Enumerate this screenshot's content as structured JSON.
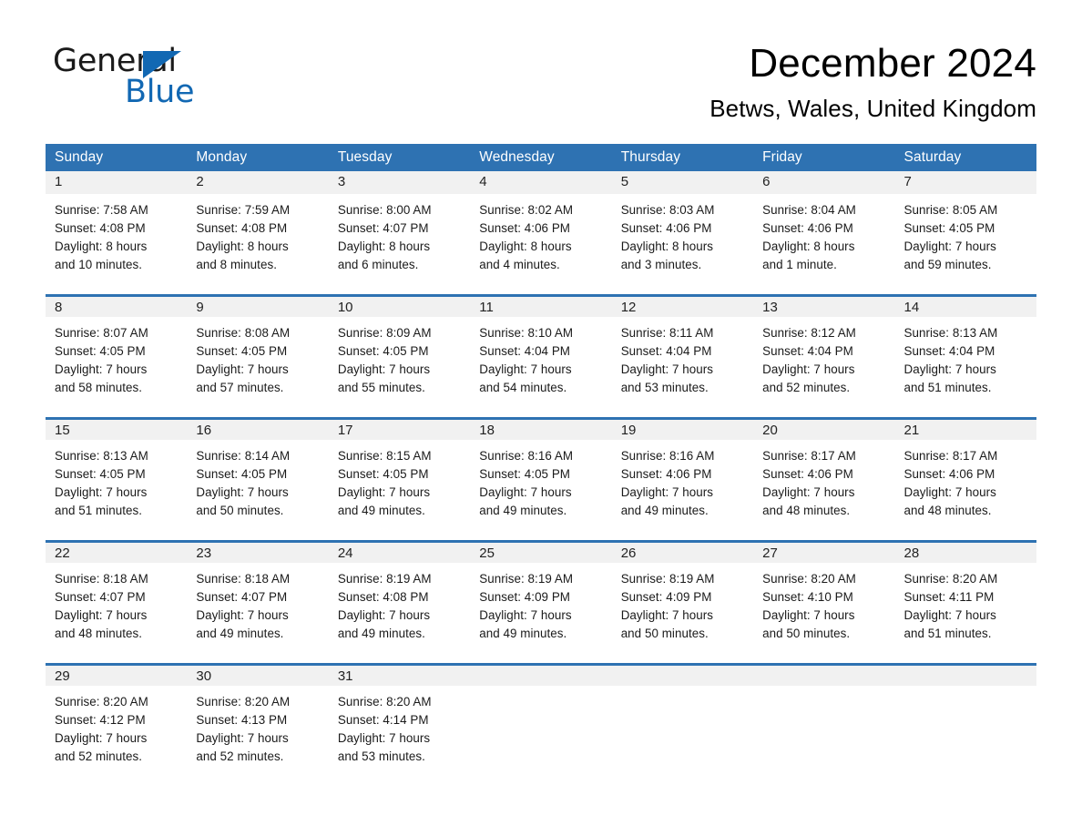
{
  "brand": {
    "name_part1": "General",
    "name_part2": "Blue",
    "accent_color": "#1268b3"
  },
  "header": {
    "month_title": "December 2024",
    "location": "Betws, Wales, United Kingdom"
  },
  "theme": {
    "header_blue": "#2e72b2",
    "date_band_gray": "#f1f1f1"
  },
  "weekdays": [
    "Sunday",
    "Monday",
    "Tuesday",
    "Wednesday",
    "Thursday",
    "Friday",
    "Saturday"
  ],
  "weeks": [
    {
      "days": [
        {
          "date": "1",
          "l1": "Sunrise: 7:58 AM",
          "l2": "Sunset: 4:08 PM",
          "l3": "Daylight: 8 hours",
          "l4": "and 10 minutes."
        },
        {
          "date": "2",
          "l1": "Sunrise: 7:59 AM",
          "l2": "Sunset: 4:08 PM",
          "l3": "Daylight: 8 hours",
          "l4": "and 8 minutes."
        },
        {
          "date": "3",
          "l1": "Sunrise: 8:00 AM",
          "l2": "Sunset: 4:07 PM",
          "l3": "Daylight: 8 hours",
          "l4": "and 6 minutes."
        },
        {
          "date": "4",
          "l1": "Sunrise: 8:02 AM",
          "l2": "Sunset: 4:06 PM",
          "l3": "Daylight: 8 hours",
          "l4": "and 4 minutes."
        },
        {
          "date": "5",
          "l1": "Sunrise: 8:03 AM",
          "l2": "Sunset: 4:06 PM",
          "l3": "Daylight: 8 hours",
          "l4": "and 3 minutes."
        },
        {
          "date": "6",
          "l1": "Sunrise: 8:04 AM",
          "l2": "Sunset: 4:06 PM",
          "l3": "Daylight: 8 hours",
          "l4": "and 1 minute."
        },
        {
          "date": "7",
          "l1": "Sunrise: 8:05 AM",
          "l2": "Sunset: 4:05 PM",
          "l3": "Daylight: 7 hours",
          "l4": "and 59 minutes."
        }
      ]
    },
    {
      "days": [
        {
          "date": "8",
          "l1": "Sunrise: 8:07 AM",
          "l2": "Sunset: 4:05 PM",
          "l3": "Daylight: 7 hours",
          "l4": "and 58 minutes."
        },
        {
          "date": "9",
          "l1": "Sunrise: 8:08 AM",
          "l2": "Sunset: 4:05 PM",
          "l3": "Daylight: 7 hours",
          "l4": "and 57 minutes."
        },
        {
          "date": "10",
          "l1": "Sunrise: 8:09 AM",
          "l2": "Sunset: 4:05 PM",
          "l3": "Daylight: 7 hours",
          "l4": "and 55 minutes."
        },
        {
          "date": "11",
          "l1": "Sunrise: 8:10 AM",
          "l2": "Sunset: 4:04 PM",
          "l3": "Daylight: 7 hours",
          "l4": "and 54 minutes."
        },
        {
          "date": "12",
          "l1": "Sunrise: 8:11 AM",
          "l2": "Sunset: 4:04 PM",
          "l3": "Daylight: 7 hours",
          "l4": "and 53 minutes."
        },
        {
          "date": "13",
          "l1": "Sunrise: 8:12 AM",
          "l2": "Sunset: 4:04 PM",
          "l3": "Daylight: 7 hours",
          "l4": "and 52 minutes."
        },
        {
          "date": "14",
          "l1": "Sunrise: 8:13 AM",
          "l2": "Sunset: 4:04 PM",
          "l3": "Daylight: 7 hours",
          "l4": "and 51 minutes."
        }
      ]
    },
    {
      "days": [
        {
          "date": "15",
          "l1": "Sunrise: 8:13 AM",
          "l2": "Sunset: 4:05 PM",
          "l3": "Daylight: 7 hours",
          "l4": "and 51 minutes."
        },
        {
          "date": "16",
          "l1": "Sunrise: 8:14 AM",
          "l2": "Sunset: 4:05 PM",
          "l3": "Daylight: 7 hours",
          "l4": "and 50 minutes."
        },
        {
          "date": "17",
          "l1": "Sunrise: 8:15 AM",
          "l2": "Sunset: 4:05 PM",
          "l3": "Daylight: 7 hours",
          "l4": "and 49 minutes."
        },
        {
          "date": "18",
          "l1": "Sunrise: 8:16 AM",
          "l2": "Sunset: 4:05 PM",
          "l3": "Daylight: 7 hours",
          "l4": "and 49 minutes."
        },
        {
          "date": "19",
          "l1": "Sunrise: 8:16 AM",
          "l2": "Sunset: 4:06 PM",
          "l3": "Daylight: 7 hours",
          "l4": "and 49 minutes."
        },
        {
          "date": "20",
          "l1": "Sunrise: 8:17 AM",
          "l2": "Sunset: 4:06 PM",
          "l3": "Daylight: 7 hours",
          "l4": "and 48 minutes."
        },
        {
          "date": "21",
          "l1": "Sunrise: 8:17 AM",
          "l2": "Sunset: 4:06 PM",
          "l3": "Daylight: 7 hours",
          "l4": "and 48 minutes."
        }
      ]
    },
    {
      "days": [
        {
          "date": "22",
          "l1": "Sunrise: 8:18 AM",
          "l2": "Sunset: 4:07 PM",
          "l3": "Daylight: 7 hours",
          "l4": "and 48 minutes."
        },
        {
          "date": "23",
          "l1": "Sunrise: 8:18 AM",
          "l2": "Sunset: 4:07 PM",
          "l3": "Daylight: 7 hours",
          "l4": "and 49 minutes."
        },
        {
          "date": "24",
          "l1": "Sunrise: 8:19 AM",
          "l2": "Sunset: 4:08 PM",
          "l3": "Daylight: 7 hours",
          "l4": "and 49 minutes."
        },
        {
          "date": "25",
          "l1": "Sunrise: 8:19 AM",
          "l2": "Sunset: 4:09 PM",
          "l3": "Daylight: 7 hours",
          "l4": "and 49 minutes."
        },
        {
          "date": "26",
          "l1": "Sunrise: 8:19 AM",
          "l2": "Sunset: 4:09 PM",
          "l3": "Daylight: 7 hours",
          "l4": "and 50 minutes."
        },
        {
          "date": "27",
          "l1": "Sunrise: 8:20 AM",
          "l2": "Sunset: 4:10 PM",
          "l3": "Daylight: 7 hours",
          "l4": "and 50 minutes."
        },
        {
          "date": "28",
          "l1": "Sunrise: 8:20 AM",
          "l2": "Sunset: 4:11 PM",
          "l3": "Daylight: 7 hours",
          "l4": "and 51 minutes."
        }
      ]
    },
    {
      "days": [
        {
          "date": "29",
          "l1": "Sunrise: 8:20 AM",
          "l2": "Sunset: 4:12 PM",
          "l3": "Daylight: 7 hours",
          "l4": "and 52 minutes."
        },
        {
          "date": "30",
          "l1": "Sunrise: 8:20 AM",
          "l2": "Sunset: 4:13 PM",
          "l3": "Daylight: 7 hours",
          "l4": "and 52 minutes."
        },
        {
          "date": "31",
          "l1": "Sunrise: 8:20 AM",
          "l2": "Sunset: 4:14 PM",
          "l3": "Daylight: 7 hours",
          "l4": "and 53 minutes."
        },
        {
          "date": "",
          "l1": "",
          "l2": "",
          "l3": "",
          "l4": ""
        },
        {
          "date": "",
          "l1": "",
          "l2": "",
          "l3": "",
          "l4": ""
        },
        {
          "date": "",
          "l1": "",
          "l2": "",
          "l3": "",
          "l4": ""
        },
        {
          "date": "",
          "l1": "",
          "l2": "",
          "l3": "",
          "l4": ""
        }
      ]
    }
  ]
}
